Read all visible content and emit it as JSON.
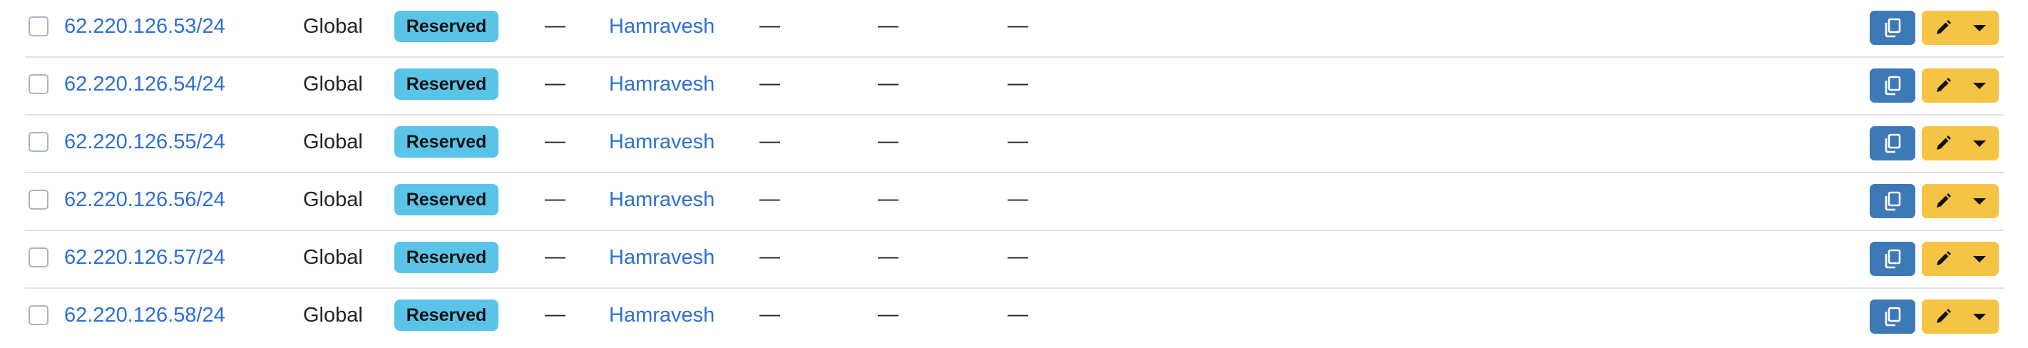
{
  "rows": [
    {
      "prefix": "62.220.126.53/24",
      "vrf": "Global",
      "status": "Reserved",
      "col4": "—",
      "tenant": "Hamravesh",
      "col6": "—",
      "col7": "—",
      "col8": "—"
    },
    {
      "prefix": "62.220.126.54/24",
      "vrf": "Global",
      "status": "Reserved",
      "col4": "—",
      "tenant": "Hamravesh",
      "col6": "—",
      "col7": "—",
      "col8": "—"
    },
    {
      "prefix": "62.220.126.55/24",
      "vrf": "Global",
      "status": "Reserved",
      "col4": "—",
      "tenant": "Hamravesh",
      "col6": "—",
      "col7": "—",
      "col8": "—"
    },
    {
      "prefix": "62.220.126.56/24",
      "vrf": "Global",
      "status": "Reserved",
      "col4": "—",
      "tenant": "Hamravesh",
      "col6": "—",
      "col7": "—",
      "col8": "—"
    },
    {
      "prefix": "62.220.126.57/24",
      "vrf": "Global",
      "status": "Reserved",
      "col4": "—",
      "tenant": "Hamravesh",
      "col6": "—",
      "col7": "—",
      "col8": "—"
    },
    {
      "prefix": "62.220.126.58/24",
      "vrf": "Global",
      "status": "Reserved",
      "col4": "—",
      "tenant": "Hamravesh",
      "col6": "—",
      "col7": "—",
      "col8": "—"
    }
  ],
  "icons": {
    "copy": "copy-icon",
    "edit": "pencil-icon",
    "dropdown": "caret-down-icon"
  },
  "colors": {
    "link": "#2c6fd6",
    "status_badge": "#5ac4e8",
    "copy_button": "#3e79b7",
    "edit_button": "#f6c444"
  }
}
